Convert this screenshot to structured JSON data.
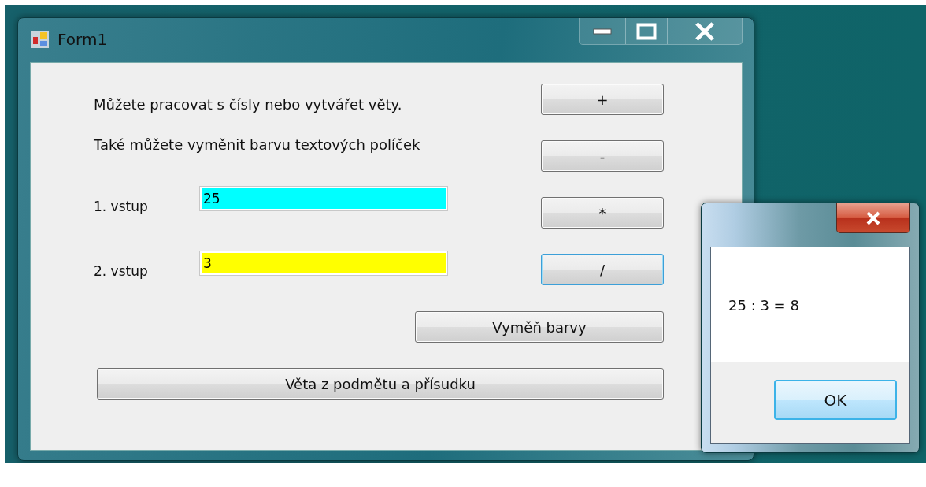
{
  "window": {
    "title": "Form1"
  },
  "labels": [
    "Můžete pracovat s čísly nebo vytvářet věty.",
    "Také můžete vyměnit barvu textových políček"
  ],
  "inputs": [
    {
      "label": "1. vstup",
      "value": "25",
      "color": "#00ffff"
    },
    {
      "label": "2. vstup",
      "value": "3",
      "color": "#ffff00"
    }
  ],
  "operation_buttons": [
    {
      "label": "+",
      "focused": false
    },
    {
      "label": "-",
      "focused": false
    },
    {
      "label": "*",
      "focused": false
    },
    {
      "label": "/",
      "focused": true
    }
  ],
  "swap_button": "Vyměň barvy",
  "sentence_button": "Věta z podmětu a přísudku",
  "message_box": {
    "message": "25 : 3 = 8",
    "button": "OK"
  }
}
